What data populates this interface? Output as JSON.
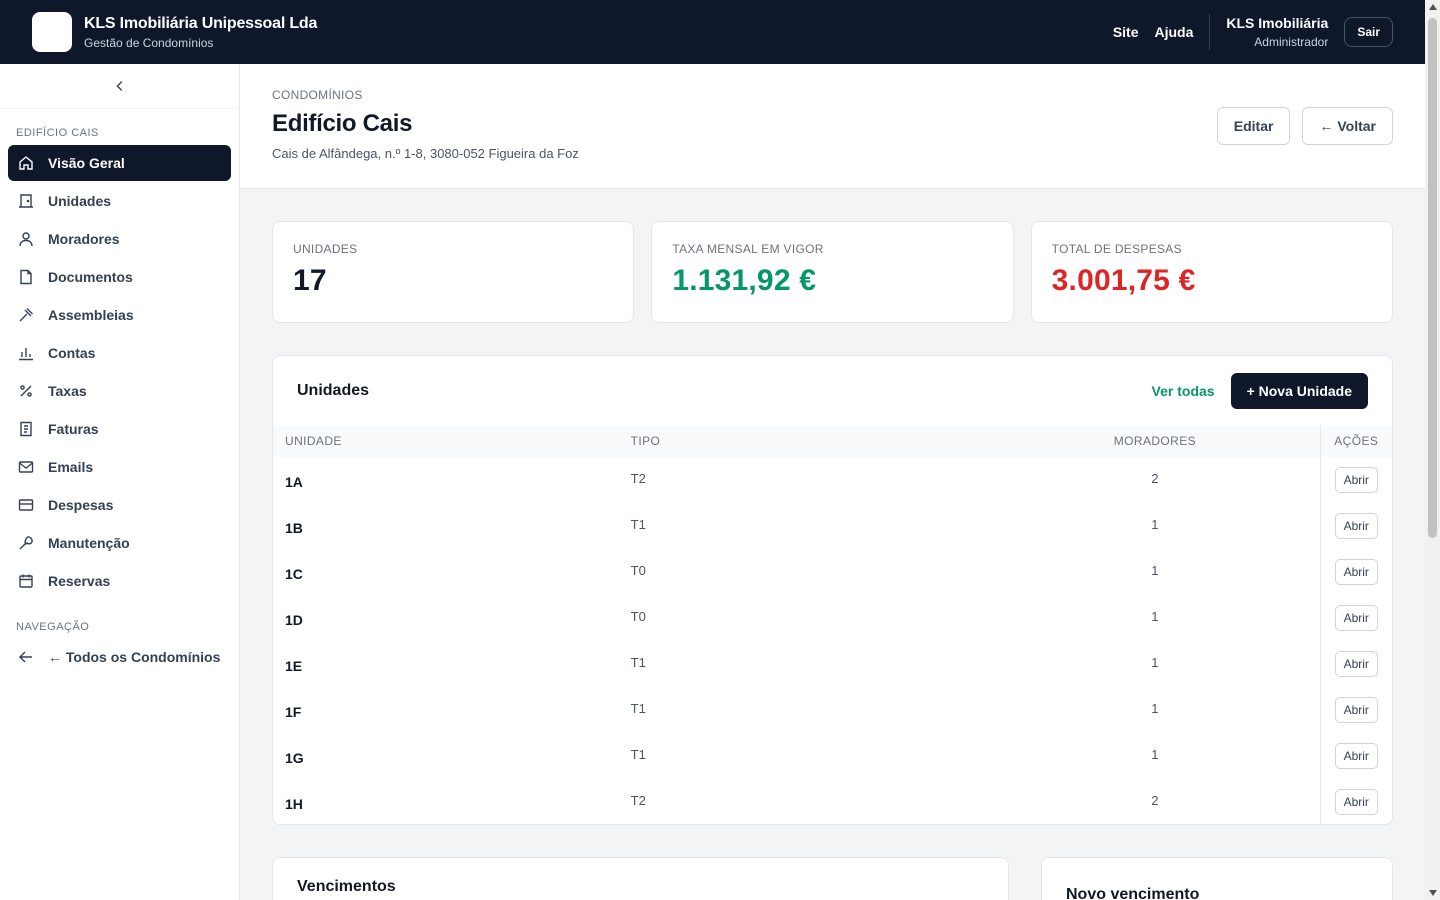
{
  "topbar": {
    "company": "KLS Imobiliária Unipessoal Lda",
    "subtitle": "Gestão de Condomínios",
    "links": [
      "Site",
      "Ajuda"
    ],
    "user_name": "KLS Imobiliária",
    "user_role": "Administrador",
    "logout_label": "Sair"
  },
  "sidebar": {
    "section_building": "EDIFÍCIO CAIS",
    "items": [
      {
        "label": "Visão Geral",
        "icon": "home-icon",
        "active": true
      },
      {
        "label": "Unidades",
        "icon": "door-icon"
      },
      {
        "label": "Moradores",
        "icon": "user-icon"
      },
      {
        "label": "Documentos",
        "icon": "file-icon"
      },
      {
        "label": "Assembleias",
        "icon": "gavel-icon"
      },
      {
        "label": "Contas",
        "icon": "bar-chart-icon"
      },
      {
        "label": "Taxas",
        "icon": "percent-icon"
      },
      {
        "label": "Faturas",
        "icon": "receipt-icon"
      },
      {
        "label": "Emails",
        "icon": "mail-icon"
      },
      {
        "label": "Despesas",
        "icon": "credit-card-icon"
      },
      {
        "label": "Manutenção",
        "icon": "wrench-icon"
      },
      {
        "label": "Reservas",
        "icon": "calendar-icon"
      }
    ],
    "section_nav": "NAVEGAÇÃO",
    "back_label": "← Todos os Condomínios"
  },
  "header": {
    "breadcrumb": "CONDOMÍNIOS",
    "title": "Edifício Cais",
    "address": "Cais de Alfândega, n.º 1-8, 3080-052 Figueira da Foz",
    "edit_label": "Editar",
    "back_label": "← Voltar"
  },
  "stats": [
    {
      "label": "UNIDADES",
      "value": "17"
    },
    {
      "label": "TAXA MENSAL EM VIGOR",
      "value": "1.131,92 €"
    },
    {
      "label": "TOTAL DE DESPESAS",
      "value": "3.001,75 €"
    }
  ],
  "colors": {
    "green": "#059669",
    "red": "#dc2626",
    "dark": "#0f172a"
  },
  "units": {
    "title": "Unidades",
    "see_all": "Ver todas",
    "new_label": "+ Nova Unidade",
    "columns": [
      "UNIDADE",
      "TIPO",
      "MORADORES",
      "AÇÕES"
    ],
    "open_label": "Abrir",
    "rows": [
      {
        "unit": "1A",
        "type": "T2",
        "residents": "2"
      },
      {
        "unit": "1B",
        "type": "T1",
        "residents": "1"
      },
      {
        "unit": "1C",
        "type": "T0",
        "residents": "1"
      },
      {
        "unit": "1D",
        "type": "T0",
        "residents": "1"
      },
      {
        "unit": "1E",
        "type": "T1",
        "residents": "1"
      },
      {
        "unit": "1F",
        "type": "T1",
        "residents": "1"
      },
      {
        "unit": "1G",
        "type": "T1",
        "residents": "1"
      },
      {
        "unit": "1H",
        "type": "T2",
        "residents": "2"
      }
    ]
  },
  "bottom": {
    "due_title": "Vencimentos",
    "new_due_title": "Novo vencimento"
  }
}
